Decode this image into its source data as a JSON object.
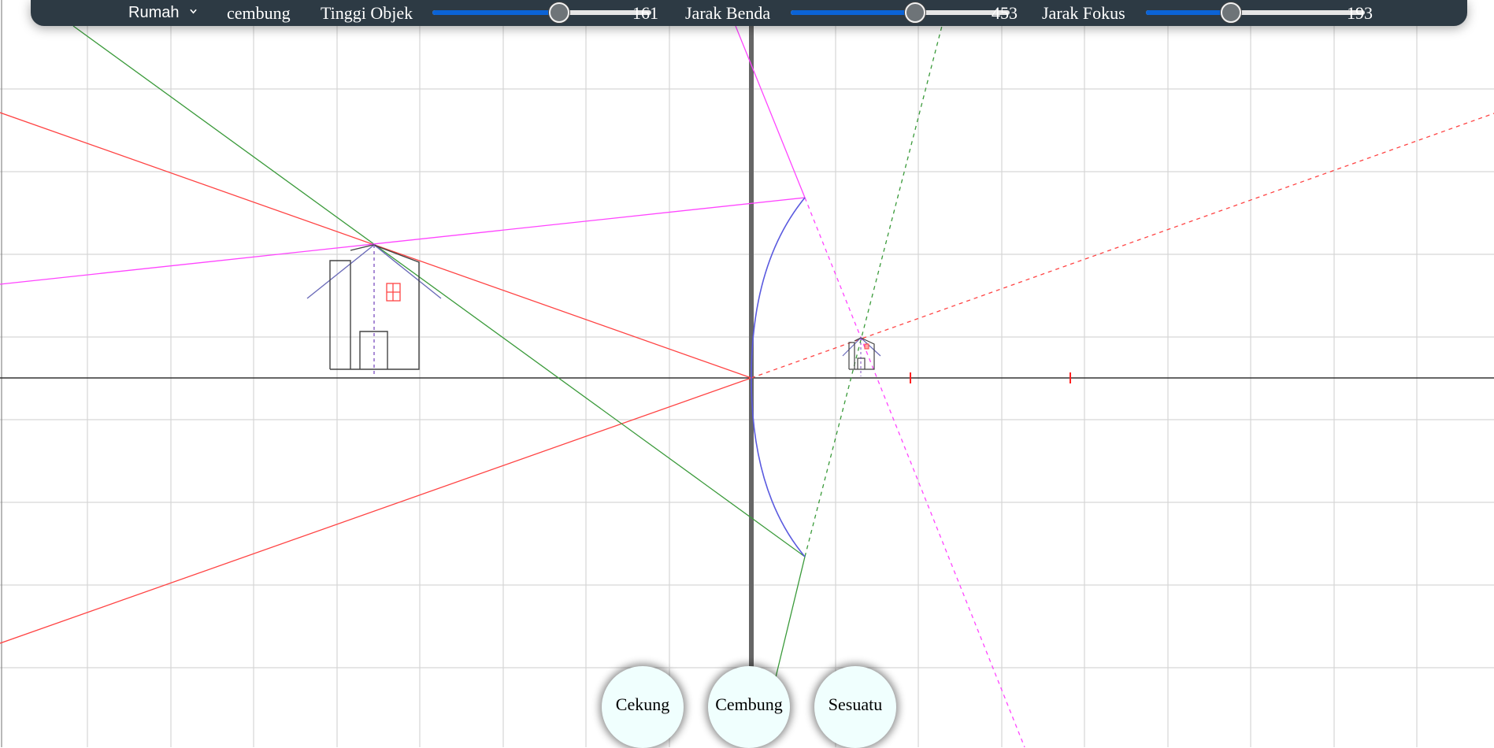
{
  "toolbar": {
    "object_select": {
      "label": "Rumah",
      "icon": "chevron-down-icon"
    },
    "mirror_type": "cembung",
    "sliders": [
      {
        "label": "Tinggi Objek",
        "value": "161",
        "fill_fraction": 0.58
      },
      {
        "label": "Jarak Benda",
        "value": "453",
        "fill_fraction": 0.57
      },
      {
        "label": "Jarak Fokus",
        "value": "193",
        "fill_fraction": 0.39
      }
    ]
  },
  "buttons": {
    "concave": "Cekung",
    "convex": "Cembung",
    "other": "Sesuatu"
  },
  "colors": {
    "toolbar_bg": "#2d3a44",
    "slider_fill": "#0b63d6",
    "ray_red": "#ff4444",
    "ray_green": "#3a9a3a",
    "ray_magenta": "#ff44ff",
    "mirror": "#5a5adf",
    "button_bg": "#f0fffe"
  }
}
